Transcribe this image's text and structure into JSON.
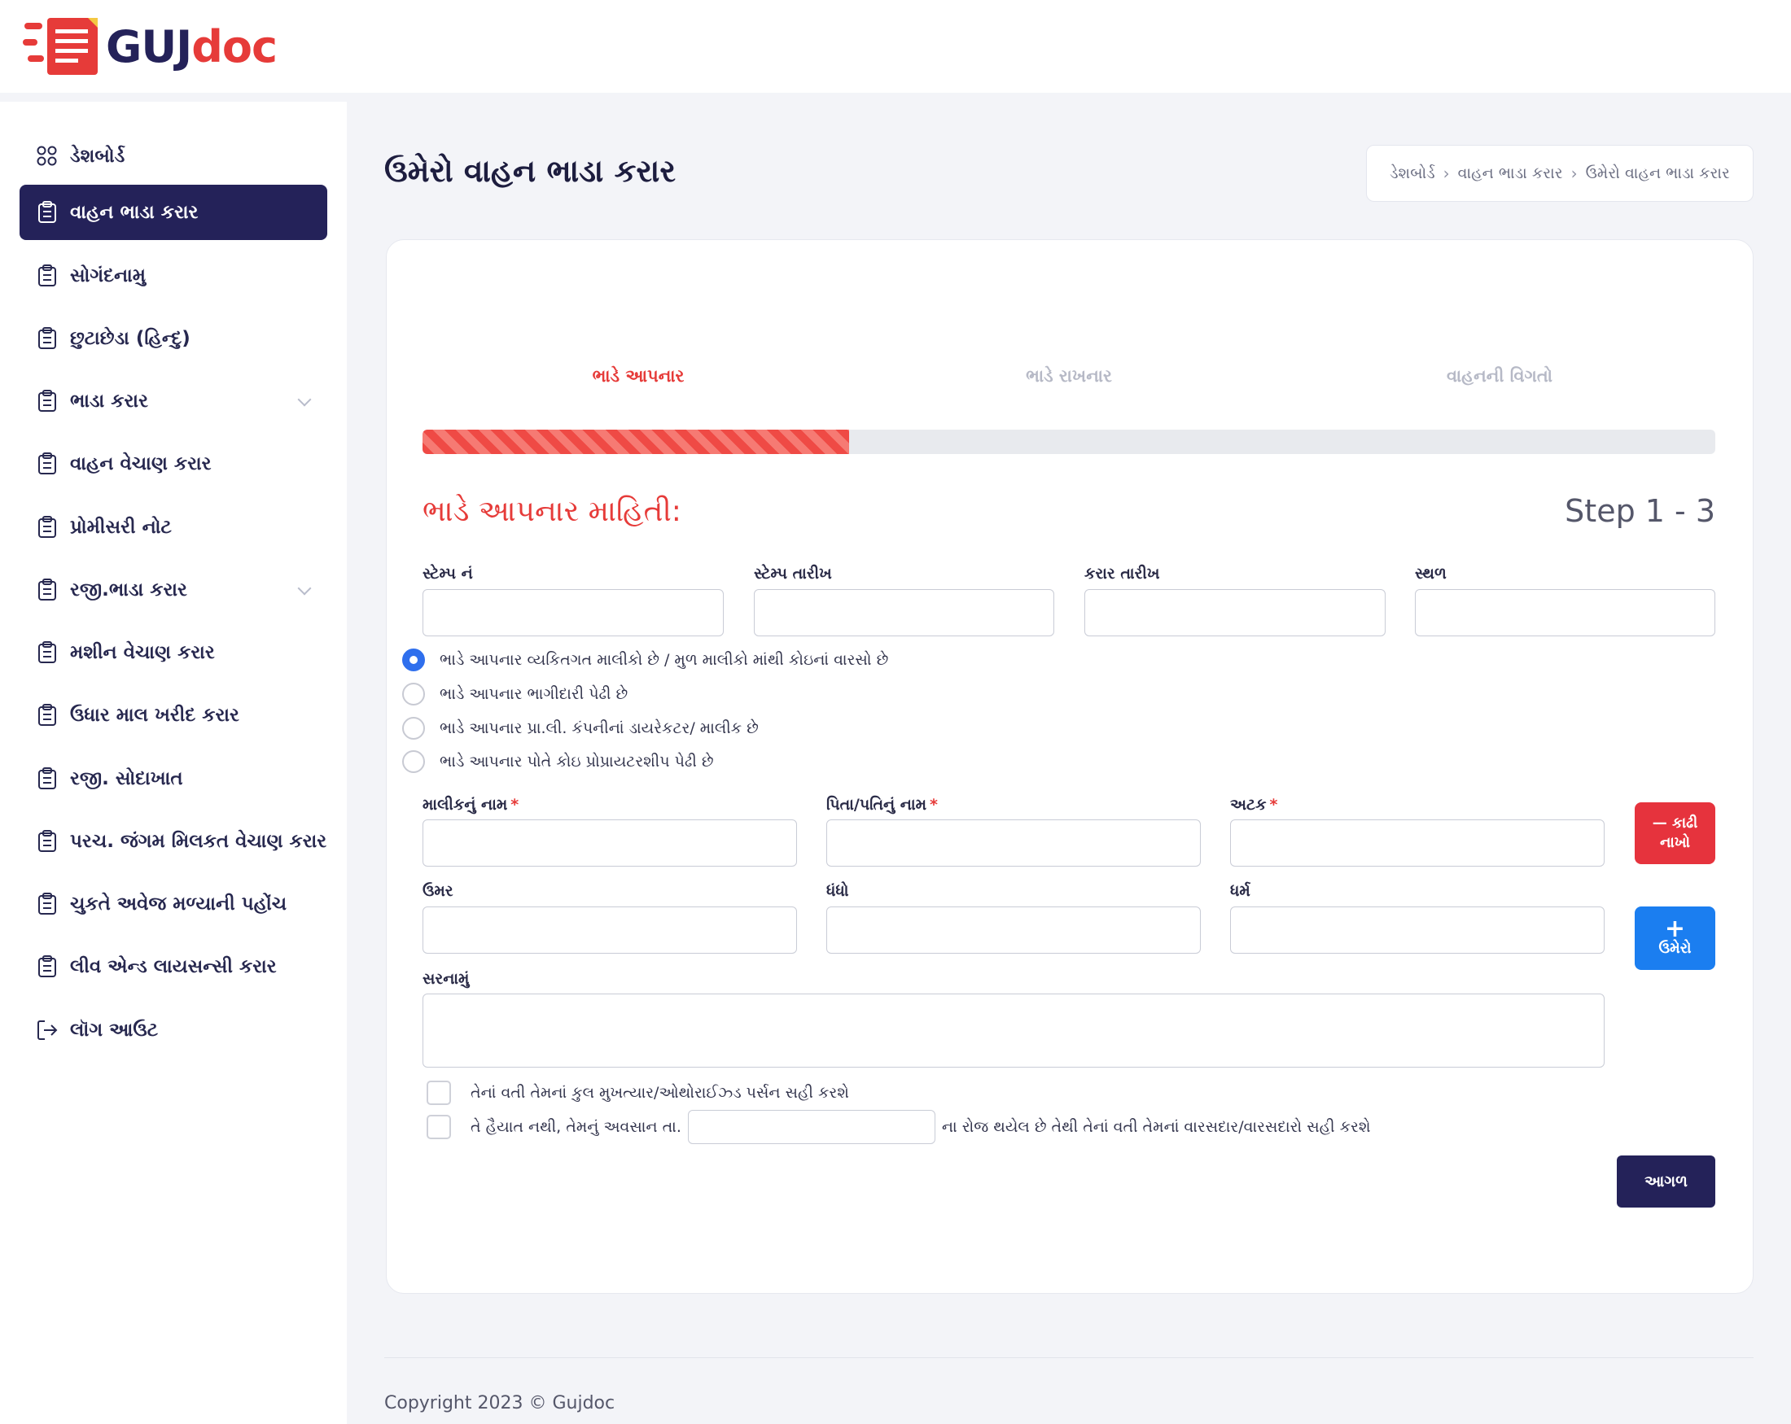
{
  "brand": {
    "name_part1": "GUJ",
    "name_part2": "doc",
    "primary": "#242259",
    "accent": "#e63b39"
  },
  "sidebar": {
    "items": [
      {
        "label": "ડેશબોર્ડ",
        "icon": "grid-icon"
      },
      {
        "label": "વાહન ભાડા કરાર",
        "icon": "clipboard-icon",
        "active": true
      },
      {
        "label": "સોગંદનામુ",
        "icon": "clipboard-icon"
      },
      {
        "label": "છુટાછેડા (હિન્દુ)",
        "icon": "clipboard-icon"
      },
      {
        "label": "ભાડા કરાર",
        "icon": "clipboard-icon",
        "has_submenu": true
      },
      {
        "label": "વાહન વેચાણ કરાર",
        "icon": "clipboard-icon"
      },
      {
        "label": "પ્રોમીસરી નોટ",
        "icon": "clipboard-icon"
      },
      {
        "label": "રજી.ભાડા કરાર",
        "icon": "clipboard-icon",
        "has_submenu": true
      },
      {
        "label": "મશીન વેચાણ કરાર",
        "icon": "clipboard-icon"
      },
      {
        "label": "ઉધાર માલ ખરીદ કરાર",
        "icon": "clipboard-icon"
      },
      {
        "label": "રજી. સોદાખાત",
        "icon": "clipboard-icon"
      },
      {
        "label": "પરચ. જંગમ મિલકત વેચાણ કરાર",
        "icon": "clipboard-icon"
      },
      {
        "label": "ચુકતે અવેજ મળ્યાની પહોંચ",
        "icon": "clipboard-icon"
      },
      {
        "label": "લીવ એન્ડ લાયસન્સી કરાર",
        "icon": "clipboard-icon"
      },
      {
        "label": "લૉગ આઉટ",
        "icon": "logout-icon"
      }
    ]
  },
  "page": {
    "title": "ઉમેરો વાહન ભાડા કરાર",
    "breadcrumb": [
      "ડેશબોર્ડ",
      "વાહન ભાડા કરાર",
      "ઉમેરો વાહન ભાડા કરાર"
    ]
  },
  "wizard": {
    "steps": [
      "ભાડે આપનાર",
      "ભાડે રાખનાર",
      "વાહનની વિગતો"
    ],
    "active_step": 1,
    "progress": 0.33,
    "section_title": "ભાડે આપનાર માહિતી:",
    "step_count": "Step 1 - 3"
  },
  "form": {
    "stamp_no": "સ્ટેમ્પ નં",
    "stamp_date": "સ્ટેમ્પ તારીખ",
    "agreement_date": "કરાર તારીખ",
    "place": "સ્થળ",
    "ownership_options": [
      "ભાડે આપનાર વ્યકિતગત માલીકો છે / મુળ માલીકો માંથી કોઇનાં વારસો છે",
      "ભાડે આપનાર ભાગીદારી પેઢી છે",
      "ભાડે આપનાર પ્રા.લી. કંપનીનાં ડાયરેકટર/ માલીક છે",
      "ભાડે આપનાર પોતે કોઇ પ્રોપ્રાયટરશીપ પેઢી છે"
    ],
    "selected_option": 0,
    "owner_name": "માલીકનું નામ",
    "father_name": "પિતા/પતિનું નામ",
    "surname": "અટક",
    "required_mark": "*",
    "age": "ઉમર",
    "occupation": "ધંધો",
    "religion": "ધર્મ",
    "address": "સરનામું",
    "remove_button": [
      "— કાઢી",
      "નાખો"
    ],
    "add_button": [
      "+",
      "ઉમેરો"
    ],
    "checkbox_poa": "તેનાં વતી તેમનાં કુલ મુખત્યાર/ઓથોરાઈઝ્ડ પર્સન સહી કરશે",
    "checkbox_deceased_before": "તે હૈયાત નથી, તેમનું અવસાન તા.",
    "checkbox_deceased_after": "ના રોજ થયેલ છે તેથી તેનાં વતી તેમનાં વારસદાર/વારસદારો સહી કરશે",
    "next_button": "આગળ"
  },
  "footer": {
    "copyright": "Copyright 2023 © Gujdoc"
  }
}
